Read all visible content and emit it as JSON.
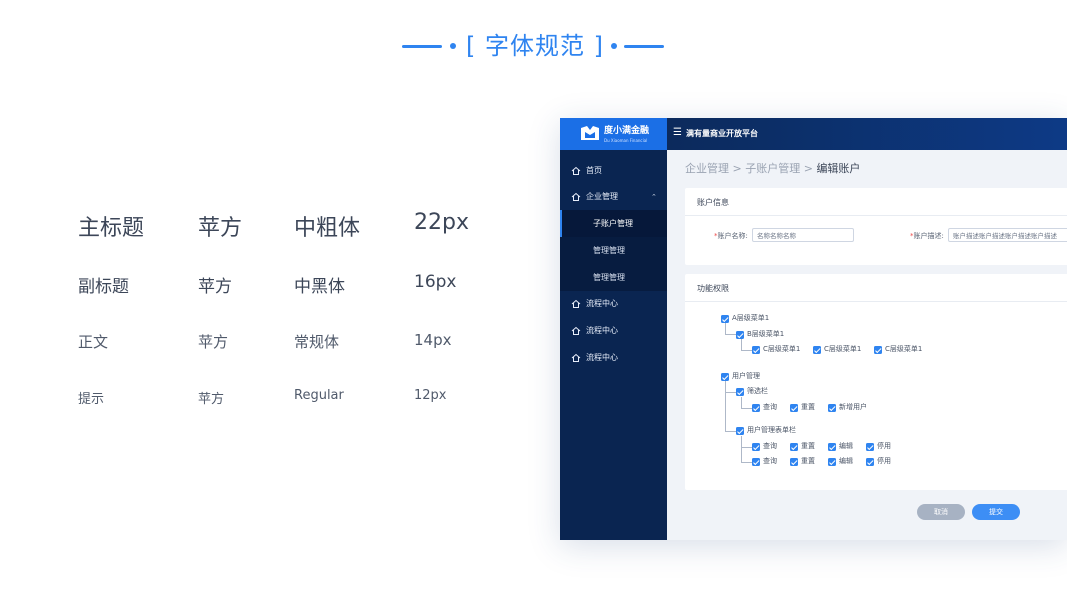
{
  "header": {
    "title": "[ 字体规范 ]"
  },
  "type_spec": {
    "rows": [
      {
        "level": "主标题",
        "font": "苹方",
        "weight": "中粗体",
        "size": "22px"
      },
      {
        "level": "副标题",
        "font": "苹方",
        "weight": "中黑体",
        "size": "16px"
      },
      {
        "level": "正文",
        "font": "苹方",
        "weight": "常规体",
        "size": "14px"
      },
      {
        "level": "提示",
        "font": "苹方",
        "weight": "Regular",
        "size": "12px"
      }
    ]
  },
  "app": {
    "brand": {
      "name": "度小满金融",
      "tagline": "Du Xiaoman Financial"
    },
    "top_title": "满有量商业开放平台",
    "menu_icon": "☰",
    "sidebar": {
      "items": [
        {
          "label": "首页",
          "icon": "home-icon"
        },
        {
          "label": "企业管理",
          "icon": "home-icon",
          "expanded": true
        },
        {
          "label": "流程中心",
          "icon": "home-icon"
        },
        {
          "label": "流程中心",
          "icon": "home-icon"
        },
        {
          "label": "流程中心",
          "icon": "home-icon"
        }
      ],
      "sub_items": [
        {
          "label": "子账户管理",
          "active": true
        },
        {
          "label": "管理管理",
          "active": false
        },
        {
          "label": "管理管理",
          "active": false
        }
      ],
      "chevron": "⌃"
    },
    "breadcrumb": {
      "part1": "企业管理",
      "sep1": " > ",
      "part2": "子账户管理",
      "sep2": " > ",
      "current": "编辑账户"
    },
    "account_card": {
      "title": "账户信息",
      "name_label": "账户名称:",
      "name_value": "名称名称名称",
      "desc_label": "账户描述:",
      "desc_value": "账户描述账户描述账户描述账户描述"
    },
    "perm_card": {
      "title": "功能权限",
      "a_menu": "A层级菜单1",
      "b_menu": "B层级菜单1",
      "c_menus": [
        "C层级菜单1",
        "C层级菜单1",
        "C层级菜单1"
      ],
      "user_mgmt": "用户管理",
      "filter_bar": "筛选栏",
      "filter_items": [
        "查询",
        "重置",
        "新增用户"
      ],
      "table_bar": "用户管理表单栏",
      "table_row1": [
        "查询",
        "重置",
        "编辑",
        "停用"
      ],
      "table_row2": [
        "查询",
        "重置",
        "编辑",
        "停用"
      ],
      "all_checked": true
    },
    "buttons": {
      "cancel": "取消",
      "submit": "提交"
    },
    "colors": {
      "accent": "#2f84f0",
      "sidebar": "#0a2551",
      "logo_bg": "#1b6fe6"
    }
  }
}
